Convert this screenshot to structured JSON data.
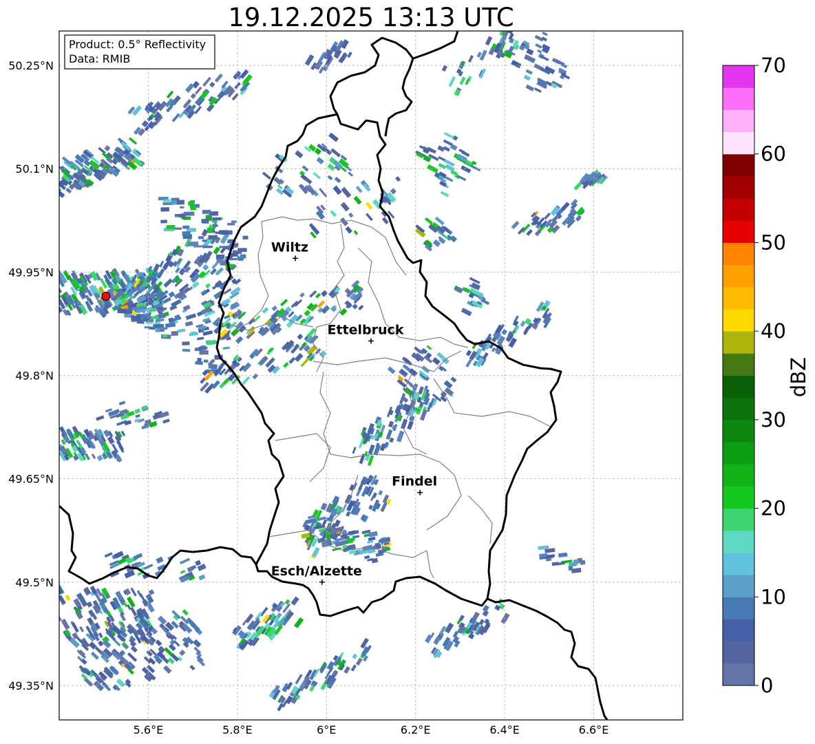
{
  "title": "19.12.2025 13:13 UTC",
  "info_box": {
    "product": "Product: 0.5° Reflectivity",
    "data": "Data: RMIB"
  },
  "map": {
    "lon_range": [
      5.4,
      6.8
    ],
    "lat_range": [
      49.3,
      50.3
    ],
    "lon_ticks": [
      {
        "value": 5.6,
        "label": "5.6°E"
      },
      {
        "value": 5.8,
        "label": "5.8°E"
      },
      {
        "value": 6.0,
        "label": "6°E"
      },
      {
        "value": 6.2,
        "label": "6.2°E"
      },
      {
        "value": 6.4,
        "label": "6.4°E"
      },
      {
        "value": 6.6,
        "label": "6.6°E"
      }
    ],
    "lat_ticks": [
      {
        "value": 50.25,
        "label": "50.25°N"
      },
      {
        "value": 50.1,
        "label": "50.1°N"
      },
      {
        "value": 49.95,
        "label": "49.95°N"
      },
      {
        "value": 49.8,
        "label": "49.8°N"
      },
      {
        "value": 49.65,
        "label": "49.65°N"
      },
      {
        "value": 49.5,
        "label": "49.5°N"
      },
      {
        "value": 49.35,
        "label": "49.35°N"
      }
    ],
    "cities": [
      {
        "name": "Wiltz",
        "lon": 5.93,
        "lat": 49.97
      },
      {
        "name": "Ettelbruck",
        "lon": 6.1,
        "lat": 49.85
      },
      {
        "name": "Findel",
        "lon": 6.21,
        "lat": 49.63
      },
      {
        "name": "Esch/Alzette",
        "lon": 5.99,
        "lat": 49.5
      }
    ],
    "radar_site": {
      "lon": 5.505,
      "lat": 49.915,
      "color": "#e8120c"
    }
  },
  "colorbar": {
    "label": "dBZ",
    "min": 0,
    "max": 70,
    "ticks": [
      {
        "value": 0,
        "label": "0"
      },
      {
        "value": 10,
        "label": "10"
      },
      {
        "value": 20,
        "label": "20"
      },
      {
        "value": 30,
        "label": "30"
      },
      {
        "value": 40,
        "label": "40"
      },
      {
        "value": 50,
        "label": "50"
      },
      {
        "value": 60,
        "label": "60"
      },
      {
        "value": 70,
        "label": "70"
      }
    ],
    "colors": [
      "#6675a8",
      "#5565a0",
      "#4560a8",
      "#4a7ab5",
      "#5aa0c8",
      "#62c2dc",
      "#5ed8c4",
      "#3ed472",
      "#14c820",
      "#10b418",
      "#0e9e14",
      "#0c8810",
      "#0c720c",
      "#086008",
      "#457a12",
      "#adb50c",
      "#ffd800",
      "#ffbb00",
      "#ffa000",
      "#ff8200",
      "#e60000",
      "#c40000",
      "#a20000",
      "#7e0000",
      "#ffe2fd",
      "#ffb0fa",
      "#ff6ef7",
      "#e635ef"
    ]
  }
}
